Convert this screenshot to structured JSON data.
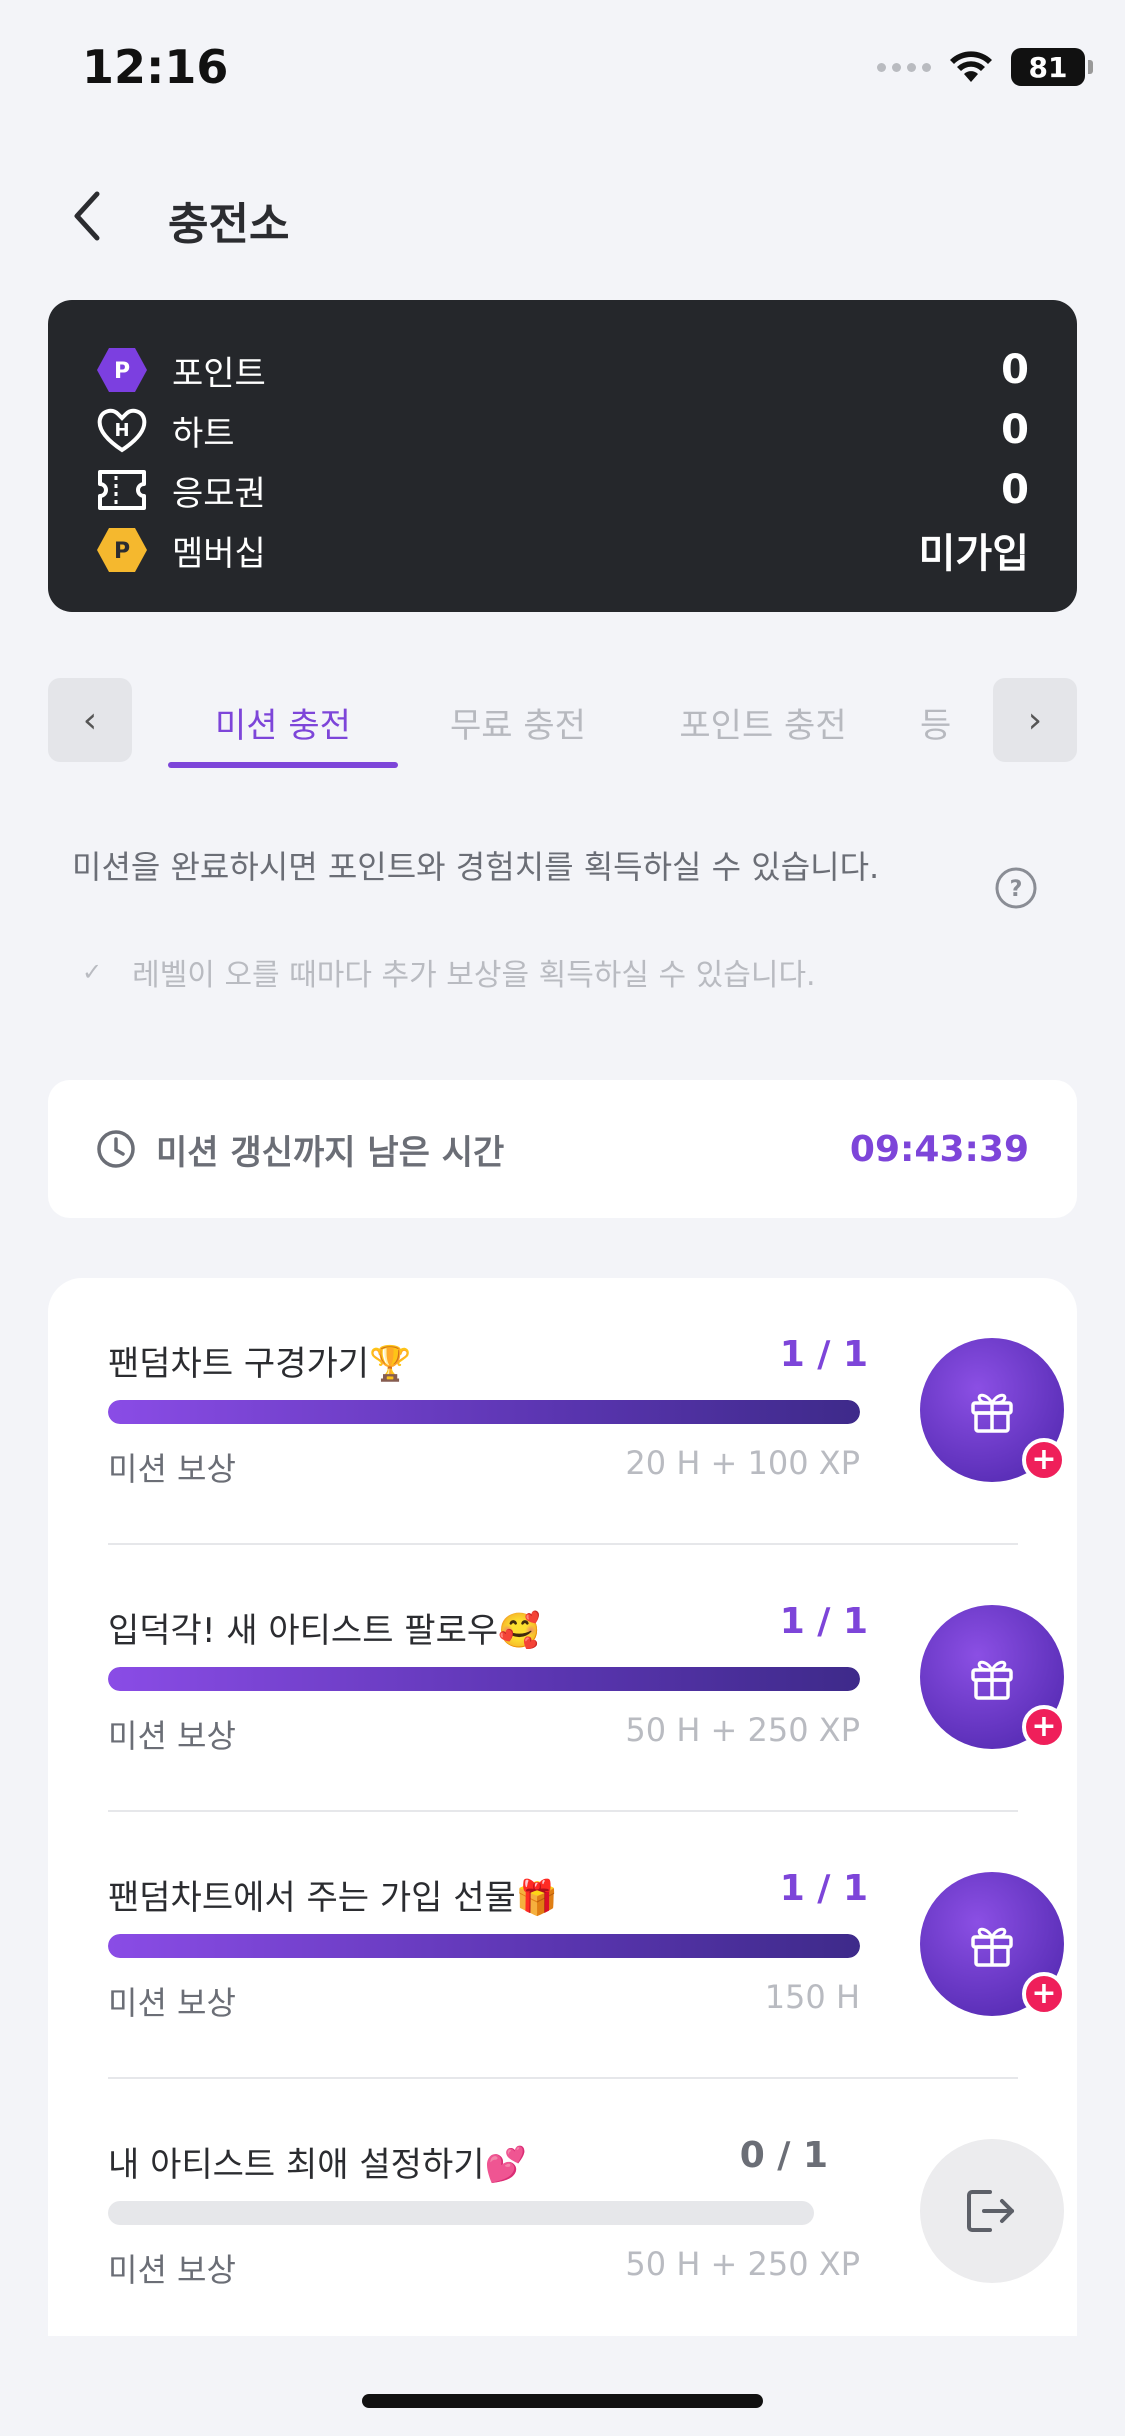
{
  "status_bar": {
    "time": "12:16",
    "battery": "81"
  },
  "header": {
    "title": "충전소"
  },
  "wallet": {
    "items": [
      {
        "icon": "point-badge-icon",
        "label": "포인트",
        "value": "0"
      },
      {
        "icon": "heart-badge-icon",
        "label": "하트",
        "value": "0"
      },
      {
        "icon": "ticket-icon",
        "label": "응모권",
        "value": "0"
      },
      {
        "icon": "membership-badge-icon",
        "label": "멤버십",
        "value": "미가입"
      }
    ]
  },
  "tabs": {
    "items": [
      {
        "label": "미션 충전",
        "active": true
      },
      {
        "label": "무료 충전",
        "active": false
      },
      {
        "label": "포인트 충전",
        "active": false
      },
      {
        "label": "등",
        "active": false
      }
    ],
    "prev_arrow": "‹",
    "next_arrow": "›"
  },
  "description": {
    "main": "미션을 완료하시면 포인트와 경험치를 획득하실 수 있습니다.",
    "sub": "레벨이 오를 때마다 추가 보상을 획득하실 수 있습니다."
  },
  "timer": {
    "label": "미션 갱신까지 남은 시간",
    "value": "09:43:39"
  },
  "missions": [
    {
      "title": "팬덤차트 구경가기🏆",
      "progress": "1 / 1",
      "completed": 1,
      "reward_label": "미션 보상",
      "reward": "20 H + 100 XP",
      "action": "claim"
    },
    {
      "title": "입덕각! 새 아티스트 팔로우🥰",
      "progress": "1 / 1",
      "completed": 1,
      "reward_label": "미션 보상",
      "reward": "50 H + 250 XP",
      "action": "claim"
    },
    {
      "title": "팬덤차트에서 주는 가입 선물🎁",
      "progress": "1 / 1",
      "completed": 1,
      "reward_label": "미션 보상",
      "reward": "150 H",
      "action": "claim"
    },
    {
      "title": "내 아티스트 최애 설정하기💕",
      "progress": "0 / 1",
      "completed": 0,
      "reward_label": "미션 보상",
      "reward": "50 H + 250 XP",
      "action": "go"
    }
  ],
  "colors": {
    "accent": "#7d45d9",
    "wallet_bg": "#25272b",
    "badge_red": "#ef1f5a",
    "hex_purple": "#7c3fe0",
    "hex_yellow": "#f5b82e"
  }
}
